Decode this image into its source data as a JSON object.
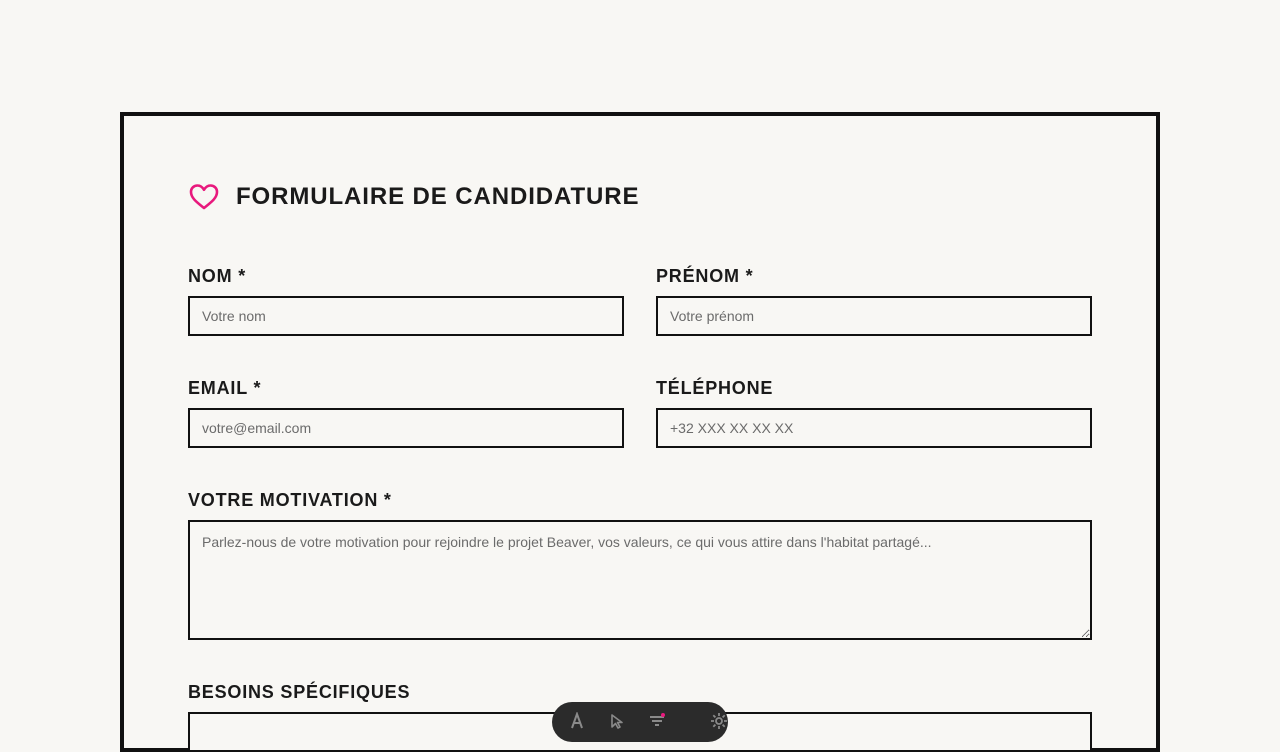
{
  "form": {
    "title": "FORMULAIRE DE CANDIDATURE",
    "accent_color": "#e8197d",
    "fields": {
      "nom": {
        "label": "NOM *",
        "placeholder": "Votre nom"
      },
      "prenom": {
        "label": "PRÉNOM *",
        "placeholder": "Votre prénom"
      },
      "email": {
        "label": "EMAIL *",
        "placeholder": "votre@email.com"
      },
      "telephone": {
        "label": "TÉLÉPHONE",
        "placeholder": "+32 XXX XX XX XX"
      },
      "motivation": {
        "label": "VOTRE MOTIVATION *",
        "placeholder": "Parlez-nous de votre motivation pour rejoindre le projet Beaver, vos valeurs, ce qui vous attire dans l'habitat partagé..."
      },
      "besoins": {
        "label": "BESOINS SPÉCIFIQUES"
      }
    }
  },
  "toolbar": {
    "icons": [
      "text-tool-icon",
      "pointer-tool-icon",
      "filter-icon",
      "settings-icon"
    ]
  }
}
